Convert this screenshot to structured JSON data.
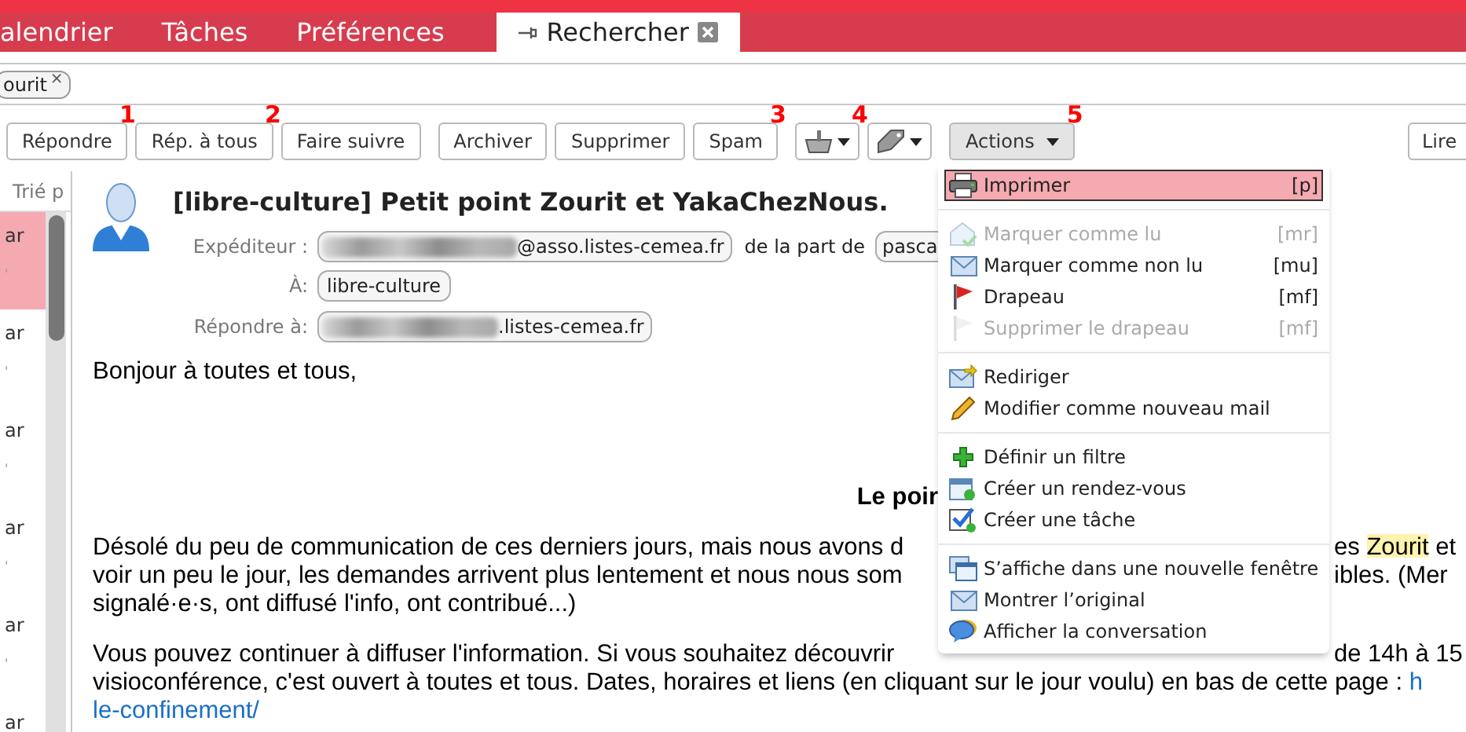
{
  "tabs": [
    {
      "label": "alendrier",
      "selected": false,
      "pinned": false,
      "closable": false
    },
    {
      "label": "Tâches",
      "selected": false,
      "pinned": false,
      "closable": false
    },
    {
      "label": "Préférences",
      "selected": false,
      "pinned": false,
      "closable": false
    },
    {
      "label": "Rechercher",
      "selected": true,
      "pinned": true,
      "closable": true
    }
  ],
  "search_tags": [
    {
      "label": "ourit",
      "close": "×"
    }
  ],
  "toolbar": [
    [
      {
        "kind": "text",
        "label": "Répondre",
        "marker": "1"
      },
      {
        "kind": "text",
        "label": "Rép. à tous",
        "marker": "2"
      },
      {
        "kind": "text",
        "label": "Faire suivre"
      }
    ],
    [
      {
        "kind": "text",
        "label": "Archiver"
      },
      {
        "kind": "text",
        "label": "Supprimer"
      },
      {
        "kind": "text",
        "label": "Spam",
        "marker": "3"
      }
    ],
    [
      {
        "kind": "print",
        "marker": "4"
      },
      {
        "kind": "tag"
      }
    ],
    [
      {
        "kind": "menu",
        "label": "Actions",
        "marker": "5",
        "expanded": true
      }
    ]
  ],
  "toolbar_right": {
    "label": "Lire"
  },
  "message_list": {
    "header": "Trié p",
    "rows": [
      {
        "line1": "ar",
        "line2": "'",
        "selected": true
      },
      {
        "line1": "ar",
        "line2": "'",
        "selected": false
      },
      {
        "line1": "ar",
        "line2": "'",
        "selected": false
      },
      {
        "line1": "ar",
        "line2": "'",
        "selected": false
      },
      {
        "line1": "ar",
        "line2": "'",
        "selected": false
      },
      {
        "line1": "ar",
        "selected": false
      }
    ]
  },
  "message": {
    "subject": "[libre-culture] Petit point Zourit et YakaChezNous.",
    "sender_label": "Expéditeur :",
    "sender": "@asso.listes-cemea.fr",
    "on_behalf": "de la part de",
    "on_behalf_name": "pasca",
    "to_label": "À:",
    "to": "libre-culture",
    "reply_label": "Répondre à:",
    "reply_to": ".listes-cemea.fr",
    "body": [
      {
        "kind": "paragraph",
        "lines": [
          {
            "left": "Bonjour à toutes et tous,"
          }
        ]
      },
      {
        "kind": "heading",
        "lines": [
          {
            "left": "Le poir"
          }
        ]
      },
      {
        "kind": "paragraph",
        "lines": [
          {
            "left": "Désolé du peu de communication de ces derniers jours, mais nous avons d",
            "right_pre": "es ",
            "right_mark": "Zourit",
            "right_post": " et"
          },
          {
            "left": "voir un peu le jour, les demandes arrivent plus lentement et nous nous som",
            "right_pre": "ibles. (Mer"
          },
          {
            "left": "signalé·e·s, ont diffusé l'info, ont contribué...)"
          }
        ]
      },
      {
        "kind": "paragraph",
        "lines": [
          {
            "left": "Vous pouvez continuer à diffuser l'information. Si vous souhaitez découvrir",
            "right_pre": "de 14h à 15"
          },
          {
            "left": "visioconférence, c'est ouvert à toutes et tous. Dates, horaires et liens (en cliquant sur le jour voulu) en bas de cette page : ",
            "left_link": "h"
          },
          {
            "left_link": "le-confinement/"
          }
        ]
      }
    ]
  },
  "actions_menu": [
    [
      {
        "label": "Imprimer",
        "shortcut": "[p]",
        "disabled": false,
        "selected": true
      }
    ],
    [
      {
        "label": "Marquer comme lu",
        "shortcut": "[mr]",
        "disabled": true,
        "selected": false
      },
      {
        "label": "Marquer comme non lu",
        "shortcut": "[mu]",
        "disabled": false,
        "selected": false
      },
      {
        "label": "Drapeau",
        "shortcut": "[mf]",
        "disabled": false,
        "selected": false
      },
      {
        "label": "Supprimer le drapeau",
        "shortcut": "[mf]",
        "disabled": true,
        "selected": false
      }
    ],
    [
      {
        "label": "Rediriger",
        "disabled": false,
        "selected": false
      },
      {
        "label": "Modifier comme nouveau mail",
        "disabled": false,
        "selected": false
      }
    ],
    [
      {
        "label": "Définir un filtre",
        "disabled": false,
        "selected": false
      },
      {
        "label": "Créer un rendez-vous",
        "disabled": false,
        "selected": false
      },
      {
        "label": "Créer une tâche",
        "disabled": false,
        "selected": false
      }
    ],
    [
      {
        "label": "S’affiche dans une nouvelle fenêtre",
        "disabled": false,
        "selected": false
      },
      {
        "label": "Montrer l’original",
        "disabled": false,
        "selected": false
      },
      {
        "label": "Afficher la conversation",
        "disabled": false,
        "selected": false
      }
    ]
  ]
}
